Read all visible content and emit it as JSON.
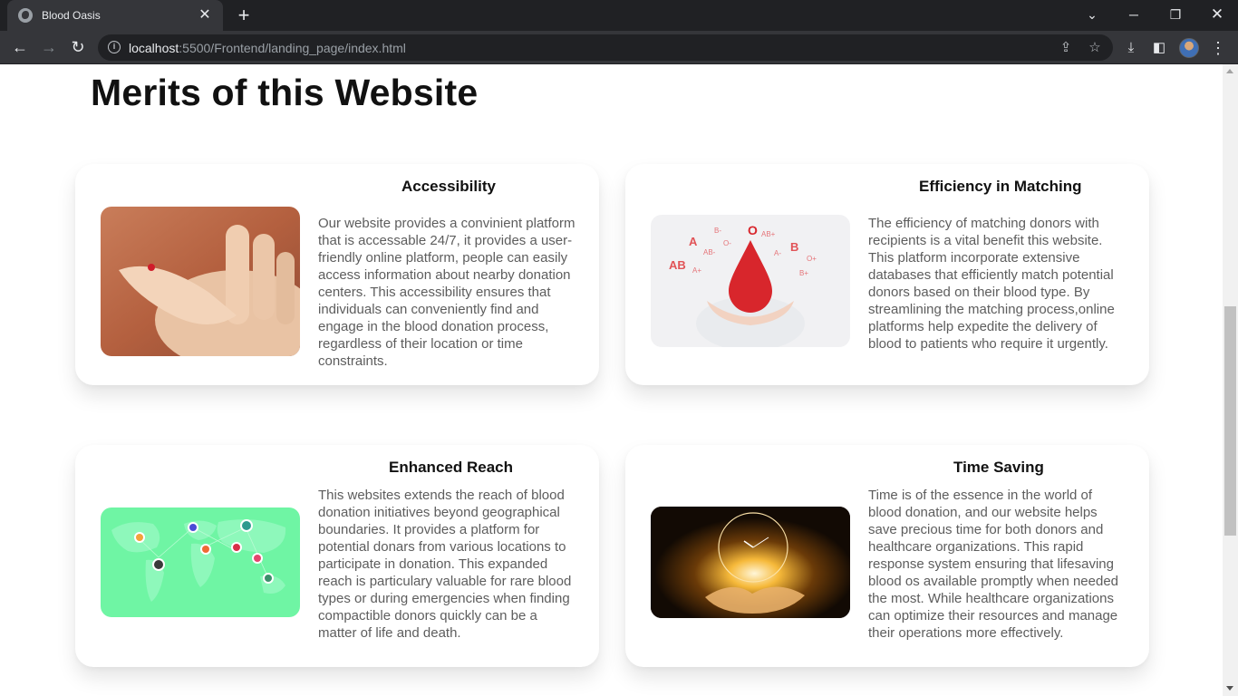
{
  "browser": {
    "tab_title": "Blood Oasis",
    "url_host": "localhost",
    "url_path": ":5500/Frontend/landing_page/index.html"
  },
  "page": {
    "section_title": "Merits of this Website",
    "cards": [
      {
        "title": "Accessibility",
        "text": "Our website provides a convinient platform that is accessable 24/7, it provides a user-friendly online platform, people can easily access information about nearby donation centers. This accessibility ensures that individuals can conveniently find and engage in the blood donation process, regardless of their location or time constraints."
      },
      {
        "title": "Efficiency in Matching",
        "text": "The efficiency of matching donors with recipients is a vital benefit this website. This platform incorporate extensive databases that efficiently match potential donors based on their blood type. By streamlining the matching process,online platforms help expedite the delivery of blood to patients who require it urgently."
      },
      {
        "title": "Enhanced Reach",
        "text": "This websites extends the reach of blood donation initiatives beyond geographical boundaries. It provides a platform for potential donars from various locations to participate in donation. This expanded reach is particulary valuable for rare blood types or during emergencies when finding compactible donors quickly can be a matter of life and death."
      },
      {
        "title": "Time Saving",
        "text": "Time is of the essence in the world of blood donation, and our website helps save precious time for both donors and healthcare organizations. This rapid response system ensuring that lifesaving blood os available promptly when needed the most. While healthcare organizations can optimize their resources and manage their operations more effectively."
      }
    ],
    "blood_types_labels": [
      "A",
      "B-",
      "O",
      "AB+",
      "AB-",
      "O-",
      "B",
      "AB",
      "A-",
      "O+",
      "A+",
      "B+"
    ]
  },
  "colors": {
    "chrome_dark": "#202124",
    "chrome_tab": "#35363a",
    "blood_red": "#d8262c",
    "map_green": "#6ff5a4",
    "text_gray": "#5d5d5d"
  }
}
